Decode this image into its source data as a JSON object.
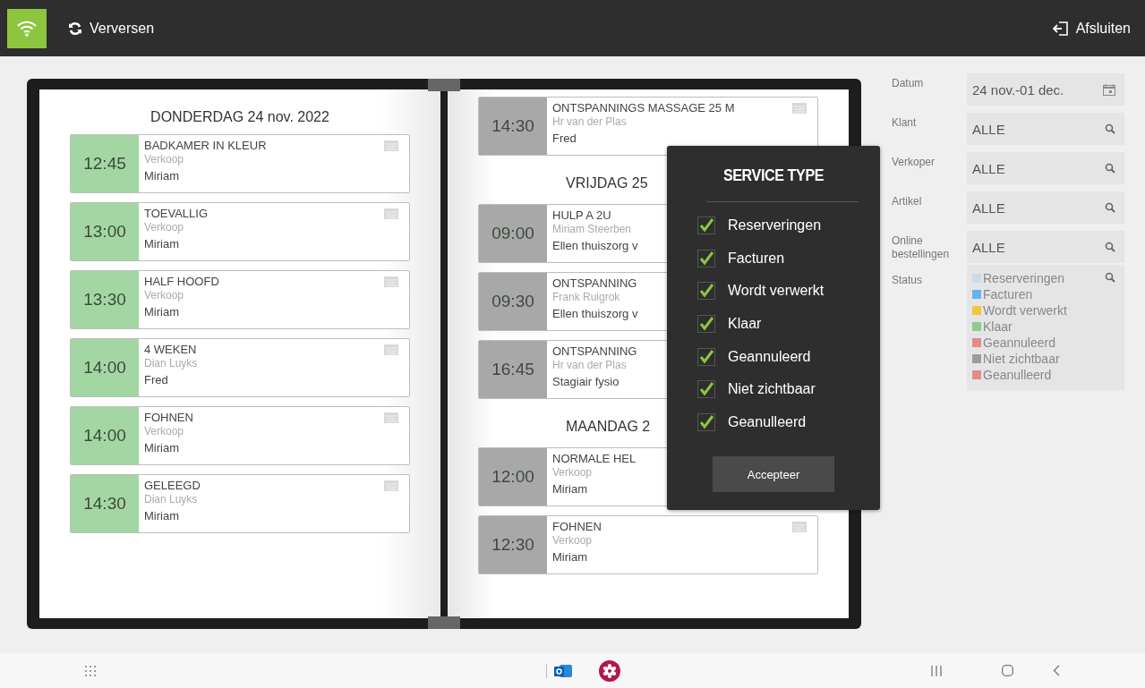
{
  "top_bar": {
    "refresh_label": "Verversen",
    "exit_label": "Afsluiten"
  },
  "agenda": {
    "pages": [
      {
        "sections": [
          {
            "heading": "DONDERDAG 24 nov. 2022",
            "appointments": [
              {
                "time": "12:45",
                "title": "BADKAMER IN KLEUR",
                "subtitle": "Verkoop",
                "person": "Miriam",
                "color": "#a3d6a3",
                "note_icon": true
              },
              {
                "time": "13:00",
                "title": "TOEVALLIG",
                "subtitle": "Verkoop",
                "person": "Miriam",
                "color": "#a3d6a3",
                "note_icon": true
              },
              {
                "time": "13:30",
                "title": "HALF HOOFD",
                "subtitle": "Verkoop",
                "person": "Miriam",
                "color": "#a3d6a3",
                "note_icon": true
              },
              {
                "time": "14:00",
                "title": "4 WEKEN",
                "subtitle": "Dian Luyks",
                "person": "Fred",
                "color": "#a3d6a3",
                "note_icon": true
              },
              {
                "time": "14:00",
                "title": "FOHNEN",
                "subtitle": "Verkoop",
                "person": "Miriam",
                "color": "#a3d6a3",
                "note_icon": true
              },
              {
                "time": "14:30",
                "title": "GELEEGD",
                "subtitle": "Dian Luyks",
                "person": "Miriam",
                "color": "#a3d6a3",
                "note_icon": true
              }
            ]
          }
        ]
      },
      {
        "sections": [
          {
            "appointments": [
              {
                "time": "14:30",
                "title": "ONTSPANNINGS MASSAGE 25 M",
                "subtitle": "Hr van der Plas",
                "person": "Fred",
                "color": "#a8a8a8",
                "note_icon": true
              }
            ]
          },
          {
            "heading": "VRIJDAG 25",
            "appointments": [
              {
                "time": "09:00",
                "title": "HULP A 2U",
                "subtitle": "Miriam Steerben",
                "person": "Ellen thuiszorg v",
                "color": "#a8a8a8",
                "note_icon": false
              },
              {
                "time": "09:30",
                "title": "ONTSPANNING",
                "subtitle": "Frank Ruigrok",
                "person": "Ellen thuiszorg v",
                "color": "#a8a8a8",
                "note_icon": false
              },
              {
                "time": "16:45",
                "title": "ONTSPANNING",
                "subtitle": "Hr van der Plas",
                "person": "Stagiair fysio",
                "color": "#a8a8a8",
                "note_icon": false
              }
            ]
          },
          {
            "heading": "MAANDAG 2",
            "appointments": [
              {
                "time": "12:00",
                "title": "NORMALE HEL",
                "subtitle": "Verkoop",
                "person": "Miriam",
                "color": "#a8a8a8",
                "note_icon": false
              },
              {
                "time": "12:30",
                "title": "FOHNEN",
                "subtitle": "Verkoop",
                "person": "Miriam",
                "color": "#a8a8a8",
                "note_icon": true
              }
            ]
          }
        ]
      }
    ]
  },
  "filters": [
    {
      "label": "Datum",
      "value": "24 nov.-01 dec.",
      "kind": "date"
    },
    {
      "label": "Klant",
      "value": "ALLE",
      "kind": "search"
    },
    {
      "label": "Verkoper",
      "value": "ALLE",
      "kind": "search"
    },
    {
      "label": "Artikel",
      "value": "ALLE",
      "kind": "search"
    },
    {
      "label": "Online bestellingen",
      "value": "ALLE",
      "kind": "search"
    }
  ],
  "status_filter": {
    "label": "Status",
    "items": [
      {
        "label": "Reserveringen",
        "color": "#c6dbec"
      },
      {
        "label": "Facturen",
        "color": "#62b4f0"
      },
      {
        "label": "Wordt verwerkt",
        "color": "#f4c63d"
      },
      {
        "label": "Klaar",
        "color": "#8ecb8e"
      },
      {
        "label": "Geannuleerd",
        "color": "#e58a8a"
      },
      {
        "label": "Niet zichtbaar",
        "color": "#9c9c9c"
      },
      {
        "label": "Geanulleerd",
        "color": "#e58a8a"
      }
    ]
  },
  "service_type_popup": {
    "title": "SERVICE TYPE",
    "options": [
      {
        "label": "Reserveringen",
        "checked": true
      },
      {
        "label": "Facturen",
        "checked": true
      },
      {
        "label": "Wordt verwerkt",
        "checked": true
      },
      {
        "label": "Klaar",
        "checked": true
      },
      {
        "label": "Geannuleerd",
        "checked": true
      },
      {
        "label": "Niet zichtbaar",
        "checked": true
      },
      {
        "label": "Geanulleerd",
        "checked": true
      }
    ],
    "button": "Accepteer"
  }
}
